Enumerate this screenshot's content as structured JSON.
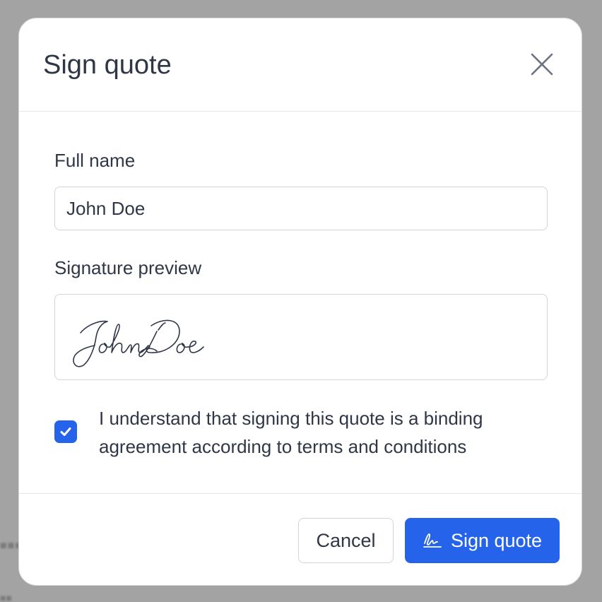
{
  "modal": {
    "title": "Sign quote",
    "close_icon": "close-icon"
  },
  "form": {
    "full_name": {
      "label": "Full name",
      "value": "John Doe"
    },
    "signature_preview": {
      "label": "Signature preview",
      "signature": "John Doe"
    },
    "consent": {
      "checked": true,
      "text": "I understand that signing this quote is a binding agreement according to terms and conditions"
    }
  },
  "footer": {
    "cancel_label": "Cancel",
    "sign_label": "Sign quote",
    "sign_icon": "signature-icon"
  },
  "colors": {
    "primary": "#2563eb",
    "text": "#2f3747",
    "border": "#d1d5db",
    "backdrop": "#a3a3a3"
  }
}
